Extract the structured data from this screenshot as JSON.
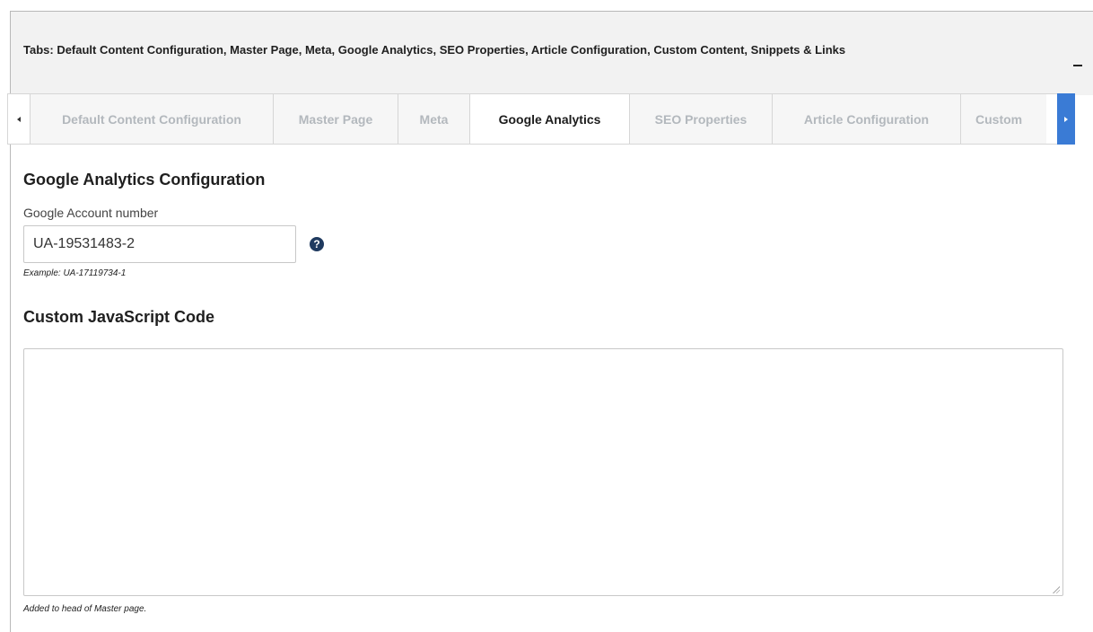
{
  "panel": {
    "header_text": "Tabs: Default Content Configuration, Master Page, Meta, Google Analytics, SEO Properties, Article Configuration, Custom Content, Snippets & Links",
    "collapse_icon": "minus-icon"
  },
  "tabs": [
    {
      "label": "Default Content Configuration",
      "active": false
    },
    {
      "label": "Master Page",
      "active": false
    },
    {
      "label": "Meta",
      "active": false
    },
    {
      "label": "Google Analytics",
      "active": true
    },
    {
      "label": "SEO Properties",
      "active": false
    },
    {
      "label": "Article Configuration",
      "active": false
    },
    {
      "label": "Custom",
      "active": false
    }
  ],
  "ga": {
    "section_title": "Google Analytics Configuration",
    "account_label": "Google Account number",
    "account_value": "UA-19531483-2",
    "account_help": "?",
    "account_example": "Example: UA-17119734-1"
  },
  "js": {
    "section_title": "Custom JavaScript Code",
    "code_value": "",
    "hint": "Added to head of Master page."
  },
  "colors": {
    "accent": "#3a7bd5",
    "help_icon_bg": "#1f3a5f",
    "header_bg": "#f2f2f2",
    "inactive_tab_text": "#b3b8bd"
  }
}
